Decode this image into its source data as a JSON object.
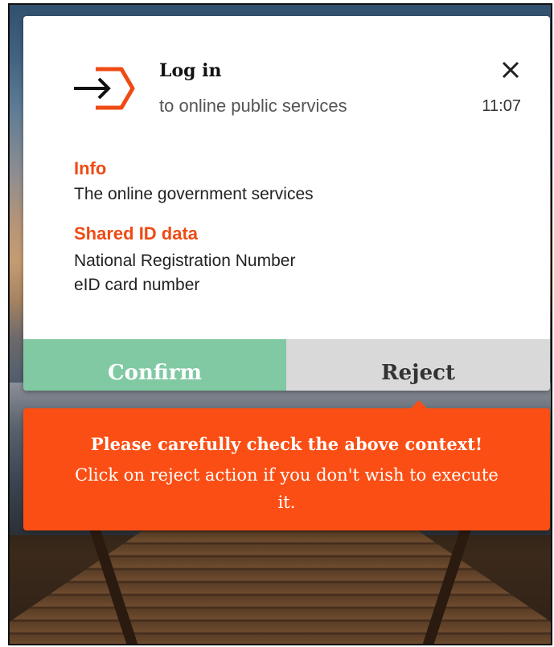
{
  "notification": {
    "title": "Log in",
    "subtitle": "to online public services",
    "time": "11:07",
    "colors": {
      "accent": "#f04a14",
      "confirm": "#80c9a3",
      "reject": "#d9d9d9",
      "warning": "#fb4e14"
    },
    "icons": {
      "logo": "login-arrow-hexagon-icon",
      "close": "close-icon"
    }
  },
  "details": {
    "info_heading": "Info",
    "info_text": "The online government services",
    "shared_heading": "Shared ID data",
    "shared_items": [
      "National Registration Number",
      "eID card number"
    ]
  },
  "actions": {
    "confirm_label": "Confirm",
    "reject_label": "Reject"
  },
  "warning": {
    "title": "Please carefully check the above context!",
    "body": "Click on reject action if you don't wish to execute it."
  }
}
